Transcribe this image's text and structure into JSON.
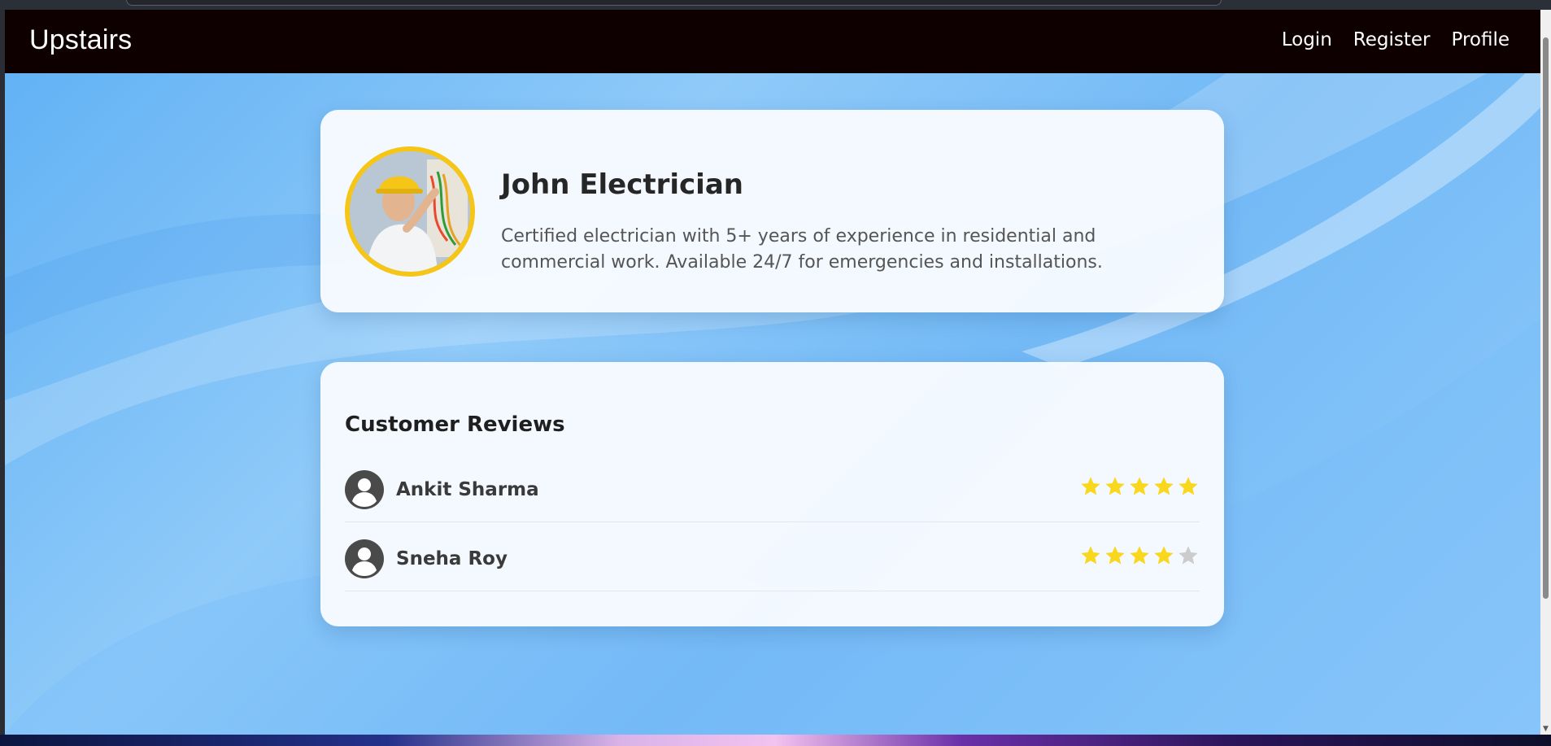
{
  "navbar": {
    "brand": "Upstairs",
    "links": [
      "Login",
      "Register",
      "Profile"
    ]
  },
  "profile": {
    "name": "John Electrician",
    "bio": "Certified electrician with 5+ years of experience in residential and commercial work. Available 24/7 for emergencies and installations.",
    "ring_color": "#f5c518"
  },
  "reviews": {
    "title": "Customer Reviews",
    "items": [
      {
        "name": "Ankit Sharma",
        "rating": 5,
        "max_rating": 5
      },
      {
        "name": "Sneha Roy",
        "rating": 4,
        "max_rating": 5
      }
    ]
  },
  "colors": {
    "navbar_bg": "#0f0000",
    "star_filled": "#f9d71c",
    "star_empty": "#cccccc",
    "accent_background": "#72b9f6"
  },
  "icons": {
    "reviewer": "user-circle-icon",
    "rating": "star-icon"
  }
}
